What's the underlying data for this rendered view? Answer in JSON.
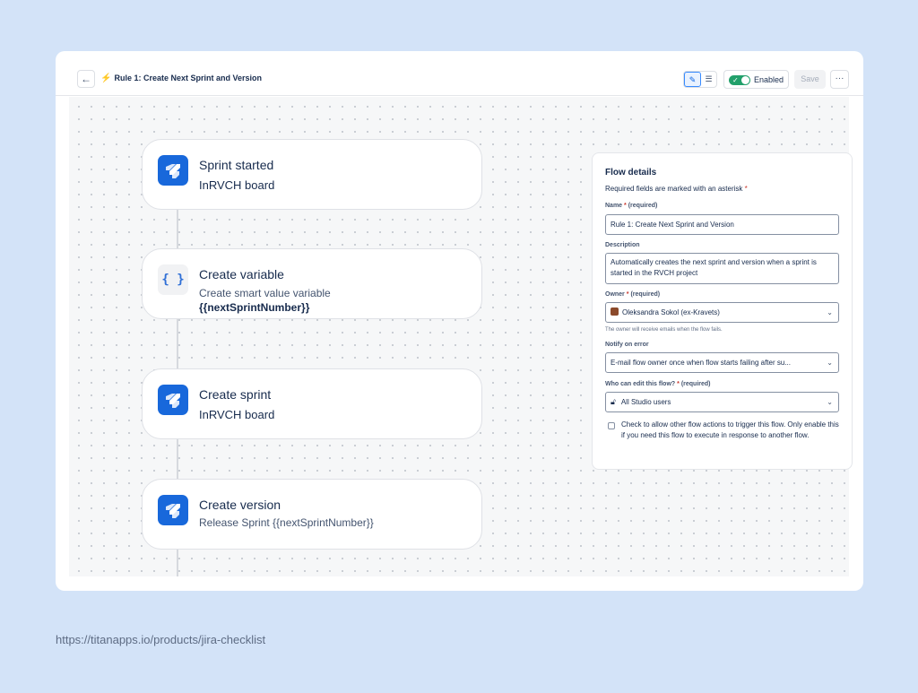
{
  "header": {
    "back_icon": "←",
    "title_icon": "⚡",
    "title": "Rule 1: Create Next Sprint and Version",
    "edit_icon": "✎",
    "list_icon": "☰",
    "toggle_label": "Enabled",
    "save_label": "Save",
    "more_label": "···"
  },
  "nodes": [
    {
      "title": "Sprint started",
      "sub_prefix": "In",
      "sub": "RVCH board"
    },
    {
      "title": "Create variable",
      "sub": "Create smart value variable",
      "sub2": "{{nextSprintNumber}}",
      "icon_text": "{ }"
    },
    {
      "title": "Create sprint",
      "sub_prefix": "In",
      "sub": "RVCH board"
    },
    {
      "title": "Create version",
      "sub": "Release Sprint {{nextSprintNumber}}"
    }
  ],
  "panel": {
    "title": "Flow details",
    "note": "Required fields are marked with an asterisk",
    "asterisk": "*",
    "name_label": "Name",
    "name_req": "(required)",
    "name_value": "Rule 1: Create Next Sprint and Version",
    "desc_label": "Description",
    "desc_value": "Automatically creates the next sprint and version when a sprint is started in the RVCH project",
    "owner_label": "Owner",
    "owner_req": "(required)",
    "owner_value": "Oleksandra Sokol (ex-Kravets)",
    "owner_help": "The owner will receive emails when the flow fails.",
    "notify_label": "Notify on error",
    "notify_value": "E-mail flow owner once when flow starts failing after su...",
    "edit_label": "Who can edit this flow?",
    "edit_req": "(required)",
    "edit_value": "All Studio users",
    "check_text": "Check to allow other flow actions to trigger this flow. Only enable this if you need this flow to execute in response to another flow."
  },
  "footer": {
    "url": "https://titanapps.io/products/jira-checklist"
  }
}
